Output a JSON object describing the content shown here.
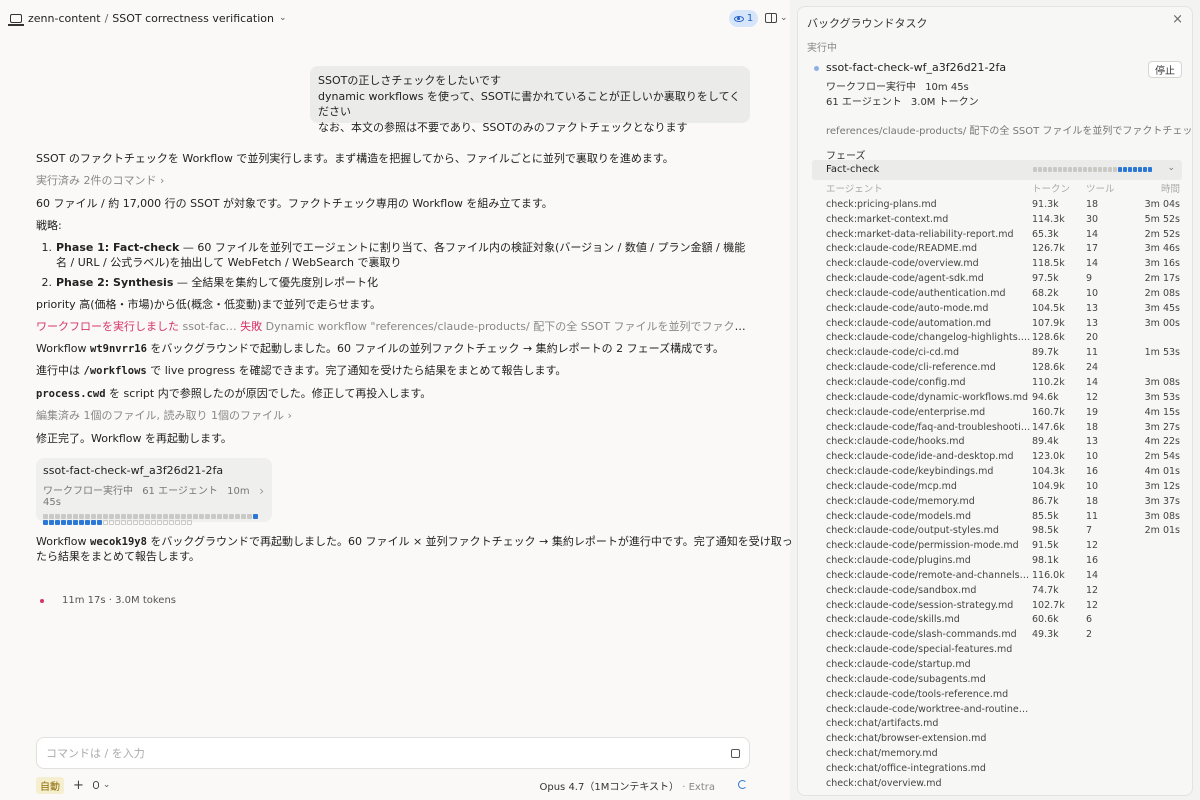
{
  "header": {
    "repo": "zenn-content",
    "separator": "/",
    "title": "SSOT correctness verification",
    "badge_count": "1"
  },
  "user_message": {
    "line1": "SSOTの正しさチェックをしたいです",
    "line2": "dynamic workflows を使って、SSOTに書かれていることが正しいか裏取りをしてください",
    "line3": "なお、本文の参照は不要であり、SSOTのみのファクトチェックとなります"
  },
  "assistant": {
    "intro": "SSOT のファクトチェックを Workflow で並列実行します。まず構造を把握してから、ファイルごとに並列で裏取りを進めます。",
    "commands_run": "実行済み 2件のコマンド",
    "scope": "60 ファイル / 約 17,000 行の SSOT が対象です。ファクトチェック専用の Workflow を組み立てます。",
    "strategy_label": "戦略:",
    "phases": [
      {
        "num": "1.",
        "name": "Phase 1: Fact-check",
        "text": " — 60 ファイルを並列でエージェントに割り当て、各ファイル内の検証対象(バージョン / 数値 / プラン金額 / 機能名 / URL / 公式ラベル)を抽出して WebFetch / WebSearch で裏取り"
      },
      {
        "num": "2.",
        "name": "Phase 2: Synthesis",
        "text": " — 全結果を集約して優先度別レポート化"
      }
    ],
    "priority": "priority 高(価格・市場)から低(概念・低変動)まで並列で走らせます。",
    "workflow_run_label": "ワークフローを実行しました",
    "workflow_run_name": "ssot-fac…",
    "workflow_run_status": "失敗",
    "workflow_run_desc": "Dynamic workflow \"references/claude-products/ 配下の全 SSOT ファイルを並列でファクトチェック\"…",
    "bg_started_pre": "Workflow ",
    "bg_started_id": "wt9nvrr16",
    "bg_started_post": " をバックグラウンドで起動しました。60 ファイルの並列ファクトチェック → 集約レポートの 2 フェーズ構成です。",
    "progress_pre": "進行中は ",
    "progress_code": "/workflows",
    "progress_post": " で live progress を確認できます。完了通知を受けたら結果をまとめて報告します。",
    "cwd_code": "process.cwd",
    "cwd_post": " を script 内で参照したのが原因でした。修正して再投入します。",
    "edited": "編集済み 1個のファイル, 読み取り 1個のファイル",
    "fixed": "修正完了。Workflow を再起動します。",
    "restart_pre": "Workflow ",
    "restart_id": "wecok19y8",
    "restart_post_1": " をバックグラウンドで再起動しました。60 ファイル × 並列ファクトチェック → 集約レポートが進行中です。完了通知を受け取っ",
    "restart_post_2": "たら結果をまとめて報告します。"
  },
  "workflow_card": {
    "name": "ssot-fact-check-wf_a3f26d21-2fa",
    "status": "ワークフロー実行中",
    "agents": "61 エージェント",
    "elapsed": "10m 45s",
    "dots": {
      "done": 35,
      "active": 11,
      "idle": 15
    }
  },
  "footer_status": "11m 17s · 3.0M tokens",
  "composer": {
    "placeholder": "コマンドは / を入力",
    "value": "",
    "auto_label": "自動",
    "plus": "+",
    "model": "Opus 4.7（1Mコンテキスト）",
    "extra": "· Extra"
  },
  "panel": {
    "title": "バックグラウンドタスク",
    "section": "実行中",
    "task_name": "ssot-fact-check-wf_a3f26d21-2fa",
    "task_status": "ワークフロー実行中",
    "task_elapsed": "10m 45s",
    "task_agents": "61 エージェント",
    "task_tokens": "3.0M トークン",
    "stop_label": "停止",
    "description": "references/claude-products/ 配下の全 SSOT ファイルを並列でファクトチェック",
    "phase_section": "フェーズ",
    "phase_name": "Fact-check",
    "phase_dots": {
      "done": 17,
      "active": 7,
      "idle": 0
    },
    "columns": {
      "agent": "エージェント",
      "tokens": "トークン",
      "tools": "ツール",
      "time": "時間"
    },
    "agents": [
      [
        "check:pricing-plans.md",
        "91.3k",
        "18",
        "3m 04s"
      ],
      [
        "check:market-context.md",
        "114.3k",
        "30",
        "5m 52s"
      ],
      [
        "check:market-data-reliability-report.md",
        "65.3k",
        "14",
        "2m 52s"
      ],
      [
        "check:claude-code/README.md",
        "126.7k",
        "17",
        "3m 46s"
      ],
      [
        "check:claude-code/overview.md",
        "118.5k",
        "14",
        "3m 16s"
      ],
      [
        "check:claude-code/agent-sdk.md",
        "97.5k",
        "9",
        "2m 17s"
      ],
      [
        "check:claude-code/authentication.md",
        "68.2k",
        "10",
        "2m 08s"
      ],
      [
        "check:claude-code/auto-mode.md",
        "104.5k",
        "13",
        "3m 45s"
      ],
      [
        "check:claude-code/automation.md",
        "107.9k",
        "13",
        "3m 00s"
      ],
      [
        "check:claude-code/changelog-highlights.md",
        "128.6k",
        "20",
        ""
      ],
      [
        "check:claude-code/ci-cd.md",
        "89.7k",
        "11",
        "1m 53s"
      ],
      [
        "check:claude-code/cli-reference.md",
        "128.6k",
        "24",
        ""
      ],
      [
        "check:claude-code/config.md",
        "110.2k",
        "14",
        "3m 08s"
      ],
      [
        "check:claude-code/dynamic-workflows.md",
        "94.6k",
        "12",
        "3m 53s"
      ],
      [
        "check:claude-code/enterprise.md",
        "160.7k",
        "19",
        "4m 15s"
      ],
      [
        "check:claude-code/faq-and-troubleshooting.…",
        "147.6k",
        "18",
        "3m 27s"
      ],
      [
        "check:claude-code/hooks.md",
        "89.4k",
        "13",
        "4m 22s"
      ],
      [
        "check:claude-code/ide-and-desktop.md",
        "123.0k",
        "10",
        "2m 54s"
      ],
      [
        "check:claude-code/keybindings.md",
        "104.3k",
        "16",
        "4m 01s"
      ],
      [
        "check:claude-code/mcp.md",
        "104.9k",
        "10",
        "3m 12s"
      ],
      [
        "check:claude-code/memory.md",
        "86.7k",
        "18",
        "3m 37s"
      ],
      [
        "check:claude-code/models.md",
        "85.5k",
        "11",
        "3m 08s"
      ],
      [
        "check:claude-code/output-styles.md",
        "98.5k",
        "7",
        "2m 01s"
      ],
      [
        "check:claude-code/permission-mode.md",
        "91.5k",
        "12",
        ""
      ],
      [
        "check:claude-code/plugins.md",
        "98.1k",
        "16",
        ""
      ],
      [
        "check:claude-code/remote-and-channels.md",
        "116.0k",
        "14",
        ""
      ],
      [
        "check:claude-code/sandbox.md",
        "74.7k",
        "12",
        ""
      ],
      [
        "check:claude-code/session-strategy.md",
        "102.7k",
        "12",
        ""
      ],
      [
        "check:claude-code/skills.md",
        "60.6k",
        "6",
        ""
      ],
      [
        "check:claude-code/slash-commands.md",
        "49.3k",
        "2",
        ""
      ],
      [
        "check:claude-code/special-features.md",
        "",
        "",
        ""
      ],
      [
        "check:claude-code/startup.md",
        "",
        "",
        ""
      ],
      [
        "check:claude-code/subagents.md",
        "",
        "",
        ""
      ],
      [
        "check:claude-code/tools-reference.md",
        "",
        "",
        ""
      ],
      [
        "check:claude-code/worktree-and-routines.md",
        "",
        "",
        ""
      ],
      [
        "check:chat/artifacts.md",
        "",
        "",
        ""
      ],
      [
        "check:chat/browser-extension.md",
        "",
        "",
        ""
      ],
      [
        "check:chat/memory.md",
        "",
        "",
        ""
      ],
      [
        "check:chat/office-integrations.md",
        "",
        "",
        ""
      ],
      [
        "check:chat/overview.md",
        "",
        "",
        ""
      ]
    ]
  },
  "colors": {
    "accent_blue": "#2b78d6",
    "error_pink": "#d6336c",
    "badge_bg": "#d7e5fb"
  },
  "icons": [
    "laptop-icon",
    "eye-icon",
    "panel-toggle-icon",
    "chevron-down-icon",
    "chevron-right-icon",
    "close-icon",
    "stop-square-icon",
    "plus-icon",
    "mic-icon",
    "spinner-icon"
  ]
}
